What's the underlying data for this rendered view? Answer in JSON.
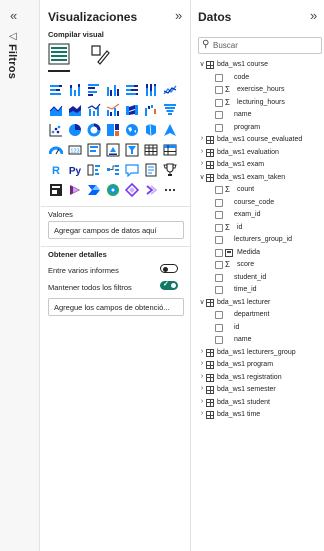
{
  "filters": {
    "collapse_glyph": "«",
    "label": "Filtros"
  },
  "visualizations": {
    "title": "Visualizaciones",
    "expand_glyph": "»",
    "build_label": "Compilar visual",
    "values_label": "Valores",
    "values_placeholder": "Agregar campos de datos aquí",
    "drill_label": "Obtener detalles",
    "cross_report_label": "Entre varios informes",
    "cross_report_on": false,
    "keep_filters_label": "Mantener todos los filtros",
    "keep_filters_on": true,
    "drill_placeholder": "Agregue los campos de obtenció...",
    "icons": [
      "stacked-bar-chart-icon",
      "stacked-column-chart-icon",
      "clustered-bar-chart-icon",
      "clustered-column-chart-icon",
      "100-stacked-bar-chart-icon",
      "100-stacked-column-chart-icon",
      "line-chart-icon",
      "area-chart-icon",
      "stacked-area-chart-icon",
      "line-and-stacked-column-icon",
      "line-and-clustered-column-icon",
      "ribbon-chart-icon",
      "waterfall-chart-icon",
      "funnel-chart-icon",
      "scatter-chart-icon",
      "pie-chart-icon",
      "donut-chart-icon",
      "treemap-icon",
      "map-icon",
      "filled-map-icon",
      "azure-map-icon",
      "gauge-icon",
      "card-icon",
      "multi-row-card-icon",
      "kpi-icon",
      "slicer-icon",
      "table-icon",
      "matrix-icon",
      "r-visual-icon",
      "python-visual-icon",
      "key-influencers-icon",
      "decomposition-tree-icon",
      "qa-icon",
      "smart-narrative-icon",
      "trophy-icon",
      "paginated-report-icon",
      "power-apps-icon",
      "power-automate-icon",
      "arcgis-map-icon",
      "diamond-visual-icon",
      "chevron-visual-icon",
      "more-visuals-icon"
    ]
  },
  "data": {
    "title": "Datos",
    "expand_glyph": "»",
    "search_placeholder": "Buscar",
    "tree": [
      {
        "type": "table",
        "name": "bda_ws1 course",
        "expanded": true
      },
      {
        "type": "field",
        "name": "code"
      },
      {
        "type": "field",
        "name": "exercise_hours",
        "sigma": true
      },
      {
        "type": "field",
        "name": "lecturing_hours",
        "sigma": true
      },
      {
        "type": "field",
        "name": "name"
      },
      {
        "type": "field",
        "name": "program"
      },
      {
        "type": "table",
        "name": "bda_ws1 course_evaluated",
        "expanded": false
      },
      {
        "type": "table",
        "name": "bda_ws1 evaluation",
        "expanded": false
      },
      {
        "type": "table",
        "name": "bda_ws1 exam",
        "expanded": false
      },
      {
        "type": "table",
        "name": "bda_ws1 exam_taken",
        "expanded": true
      },
      {
        "type": "field",
        "name": "count",
        "sigma": true
      },
      {
        "type": "field",
        "name": "course_code"
      },
      {
        "type": "field",
        "name": "exam_id"
      },
      {
        "type": "field",
        "name": "id",
        "sigma": true
      },
      {
        "type": "field",
        "name": "lecturers_group_id"
      },
      {
        "type": "field",
        "name": "Medida",
        "calc": true
      },
      {
        "type": "field",
        "name": "score",
        "sigma": true
      },
      {
        "type": "field",
        "name": "student_id"
      },
      {
        "type": "field",
        "name": "time_id"
      },
      {
        "type": "table",
        "name": "bda_ws1 lecturer",
        "expanded": true
      },
      {
        "type": "field",
        "name": "department"
      },
      {
        "type": "field",
        "name": "id"
      },
      {
        "type": "field",
        "name": "name"
      },
      {
        "type": "table",
        "name": "bda_ws1 lecturers_group",
        "expanded": false
      },
      {
        "type": "table",
        "name": "bda_ws1 program",
        "expanded": false
      },
      {
        "type": "table",
        "name": "bda_ws1 registration",
        "expanded": false
      },
      {
        "type": "table",
        "name": "bda_ws1 semester",
        "expanded": false
      },
      {
        "type": "table",
        "name": "bda_ws1 student",
        "expanded": false
      },
      {
        "type": "table",
        "name": "bda_ws1 time",
        "expanded": false
      }
    ]
  },
  "colors": {
    "accent": "#117865",
    "text": "#252423",
    "border": "#c8c8c8",
    "blue": "#118dff"
  }
}
